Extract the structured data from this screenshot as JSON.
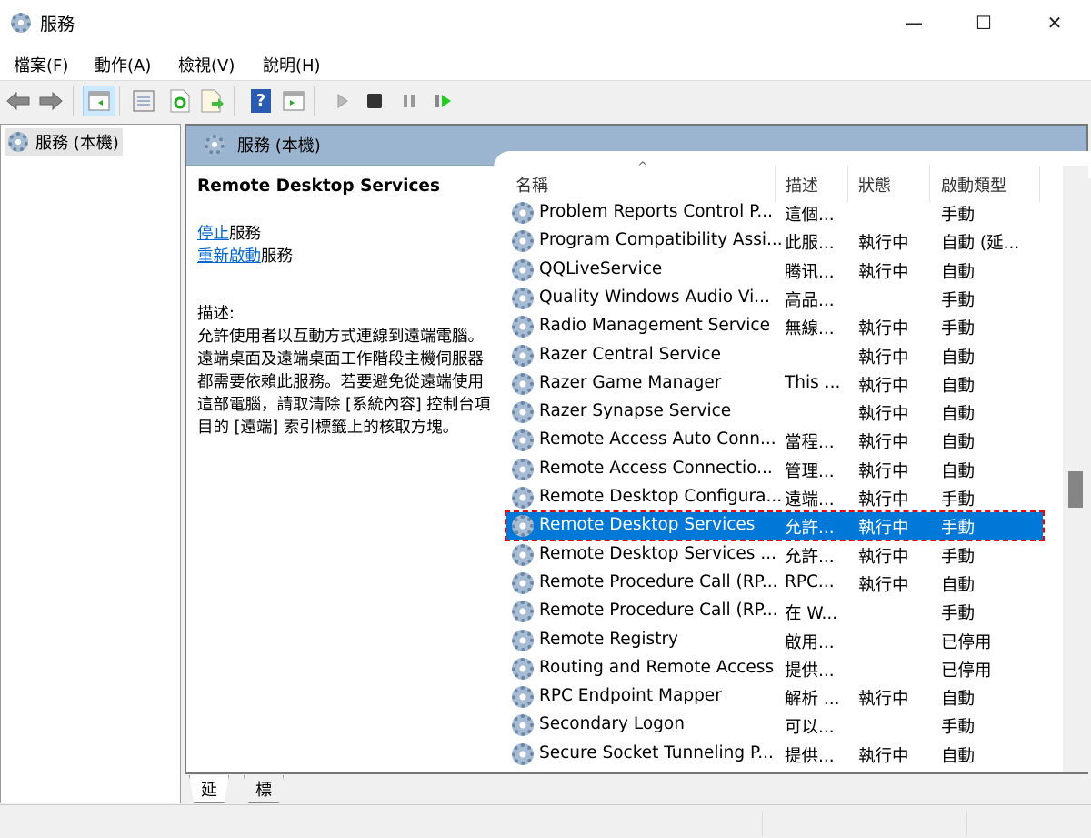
{
  "window": {
    "title": "服務",
    "minimize": "—",
    "maximize": "☐",
    "close": "✕"
  },
  "menu": [
    "檔案(F)",
    "動作(A)",
    "檢視(V)",
    "說明(H)"
  ],
  "toolbar": {
    "icons": [
      "back-icon",
      "forward-icon",
      "show-hide-console-tree-icon",
      "properties-icon",
      "refresh-icon",
      "export-list-icon",
      "help-icon",
      "show-action-pane-icon",
      "start-service-icon",
      "stop-service-icon",
      "pause-service-icon",
      "restart-service-icon"
    ],
    "help": "?"
  },
  "tree": {
    "item": "服務 (本機)"
  },
  "panel": {
    "title": "服務 (本機)"
  },
  "detail": {
    "name": "Remote Desktop Services",
    "stop_link": "停止",
    "stop_suffix": "服務",
    "restart_link": "重新啟動",
    "restart_suffix": "服務",
    "desc_label": "描述:",
    "desc": "允許使用者以互動方式連線到遠端電腦。遠端桌面及遠端桌面工作階段主機伺服器都需要依賴此服務。若要避免從遠端使用這部電腦，請取清除 [系統內容] 控制台項目的 [遠端] 索引標籤上的核取方塊。"
  },
  "columns": {
    "sort": "^",
    "name": "名稱",
    "desc": "描述",
    "status": "狀態",
    "startup": "啟動類型"
  },
  "rows": [
    {
      "name": "Problem Reports Control P...",
      "desc": "這個...",
      "status": "",
      "startup": "手動"
    },
    {
      "name": "Program Compatibility Assi...",
      "desc": "此服...",
      "status": "執行中",
      "startup": "自動 (延..."
    },
    {
      "name": "QQLiveService",
      "desc": "腾讯...",
      "status": "執行中",
      "startup": "自動"
    },
    {
      "name": "Quality Windows Audio Vi...",
      "desc": "高品...",
      "status": "",
      "startup": "手動"
    },
    {
      "name": "Radio Management Service",
      "desc": "無線...",
      "status": "執行中",
      "startup": "手動"
    },
    {
      "name": "Razer Central Service",
      "desc": "",
      "status": "執行中",
      "startup": "自動"
    },
    {
      "name": "Razer Game Manager",
      "desc": "This ...",
      "status": "執行中",
      "startup": "自動"
    },
    {
      "name": "Razer Synapse Service",
      "desc": "",
      "status": "執行中",
      "startup": "自動"
    },
    {
      "name": "Remote Access Auto Conn...",
      "desc": "當程...",
      "status": "執行中",
      "startup": "自動"
    },
    {
      "name": "Remote Access Connectio...",
      "desc": "管理...",
      "status": "執行中",
      "startup": "自動"
    },
    {
      "name": "Remote Desktop Configura...",
      "desc": "遠端...",
      "status": "執行中",
      "startup": "手動"
    },
    {
      "name": "Remote Desktop Services",
      "desc": "允許...",
      "status": "執行中",
      "startup": "手動",
      "selected": true
    },
    {
      "name": "Remote Desktop Services ...",
      "desc": "允許...",
      "status": "執行中",
      "startup": "手動"
    },
    {
      "name": "Remote Procedure Call (RP...",
      "desc": "RPC...",
      "status": "執行中",
      "startup": "自動"
    },
    {
      "name": "Remote Procedure Call (RP...",
      "desc": "在 W...",
      "status": "",
      "startup": "手動"
    },
    {
      "name": "Remote Registry",
      "desc": "啟用...",
      "status": "",
      "startup": "已停用"
    },
    {
      "name": "Routing and Remote Access",
      "desc": "提供...",
      "status": "",
      "startup": "已停用"
    },
    {
      "name": "RPC Endpoint Mapper",
      "desc": "解析 ...",
      "status": "執行中",
      "startup": "自動"
    },
    {
      "name": "Secondary Logon",
      "desc": "可以...",
      "status": "",
      "startup": "手動"
    },
    {
      "name": "Secure Socket Tunneling P...",
      "desc": "提供...",
      "status": "執行中",
      "startup": "自動"
    }
  ],
  "tabs": [
    "延伸",
    "標準"
  ],
  "colors": {
    "selection": "#0078d7",
    "band": "#9bb4d0",
    "link": "#0066cc",
    "highlight_border": "#e00000"
  }
}
